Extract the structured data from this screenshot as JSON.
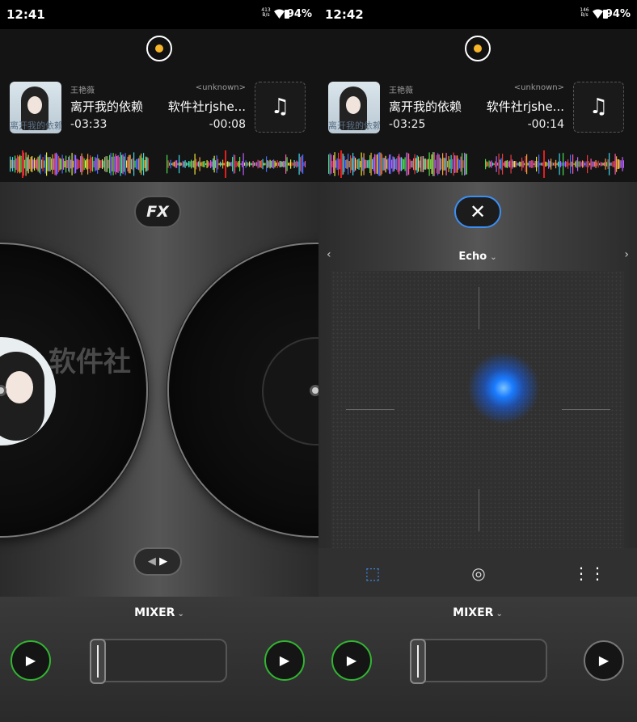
{
  "screens": [
    {
      "status": {
        "time": "12:41",
        "net_speed": "413",
        "net_unit": "B/s",
        "battery": "94%"
      },
      "deck_a": {
        "artist": "王艳薇",
        "title": "离开我的依赖",
        "remaining": "-03:33",
        "cover_caption": "离开我的依赖"
      },
      "deck_b": {
        "artist": "<unknown>",
        "title": "软件社rjshe...",
        "remaining": "-00:08",
        "load_icon": "music-note-icon"
      },
      "fx_button": "FX",
      "watermark": "软件社",
      "mixer": {
        "label": "MIXER",
        "crossfader": 0
      }
    },
    {
      "status": {
        "time": "12:42",
        "net_speed": "146",
        "net_unit": "B/s",
        "battery": "94%"
      },
      "deck_a": {
        "artist": "王艳薇",
        "title": "离开我的依赖",
        "remaining": "-03:25",
        "cover_caption": "离开我的依赖"
      },
      "deck_b": {
        "artist": "<unknown>",
        "title": "软件社rjshe...",
        "remaining": "-00:14",
        "load_icon": "music-note-icon"
      },
      "fx_panel": {
        "close_icon": "close-icon",
        "effect_name": "Echo",
        "tabs": [
          "pad-mode-icon",
          "radial-mode-icon",
          "grid-mode-icon"
        ],
        "active_color": "#3b8ff3"
      },
      "mixer": {
        "label": "MIXER",
        "crossfader": 0
      }
    }
  ],
  "colors": {
    "play_active": "#31b531",
    "accent": "#3b8ff3",
    "center_dot": "#f5b42a"
  }
}
